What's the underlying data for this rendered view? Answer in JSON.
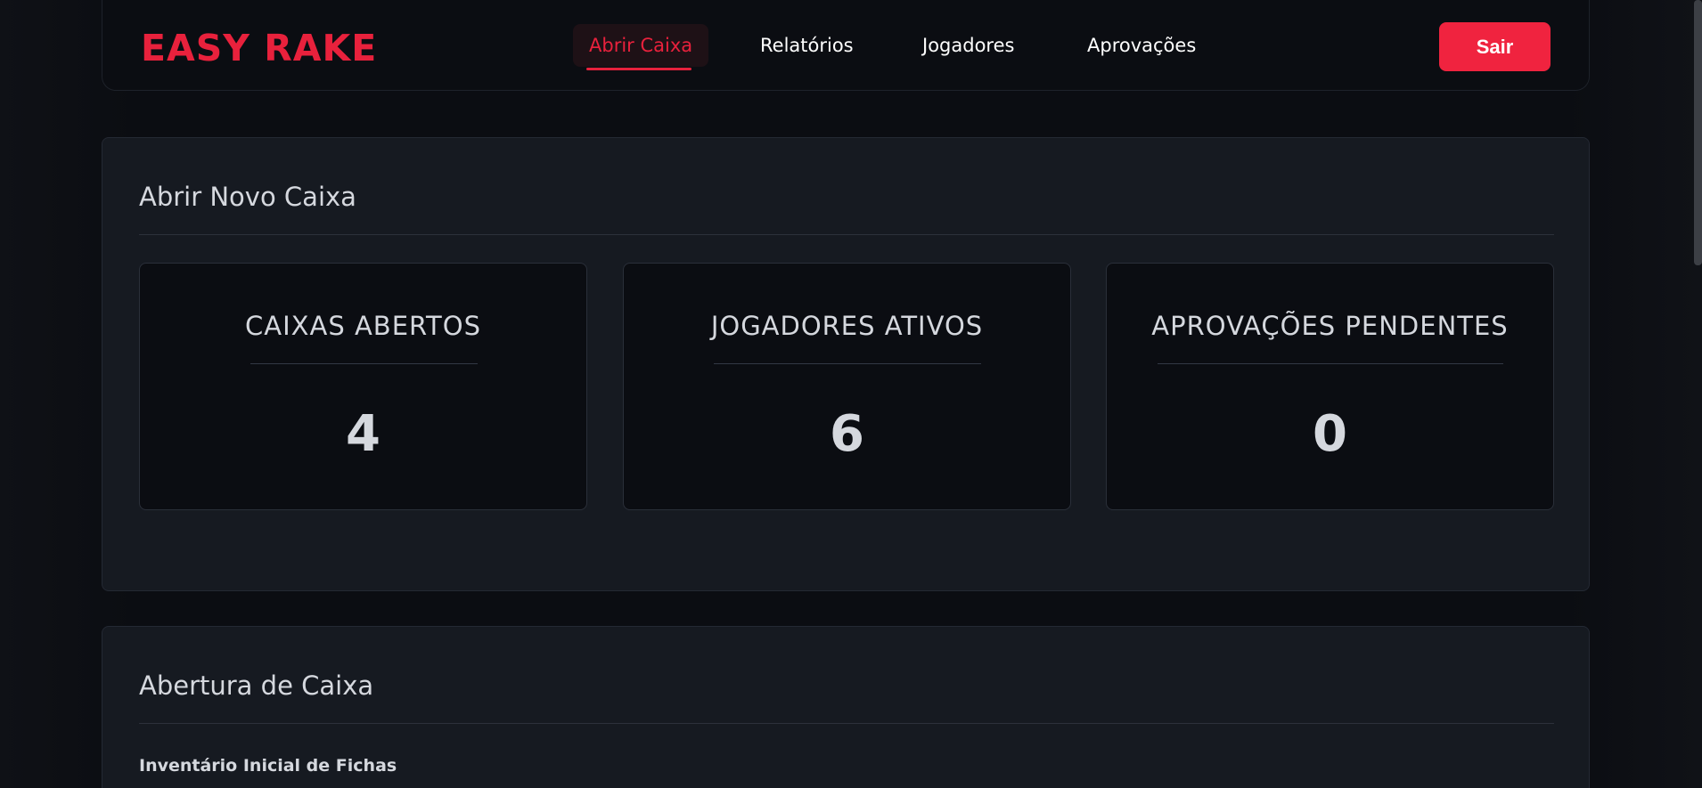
{
  "header": {
    "brand": "EASY RAKE",
    "nav": [
      {
        "label": "Abrir Caixa",
        "active": true
      },
      {
        "label": "Relatórios",
        "active": false
      },
      {
        "label": "Jogadores",
        "active": false
      },
      {
        "label": "Aprovações",
        "active": false
      }
    ],
    "logout_label": "Sair"
  },
  "panel_open": {
    "title": "Abrir Novo Caixa",
    "stats": [
      {
        "label": "CAIXAS ABERTOS",
        "value": "4"
      },
      {
        "label": "JOGADORES ATIVOS",
        "value": "6"
      },
      {
        "label": "APROVAÇÕES PENDENTES",
        "value": "0"
      }
    ]
  },
  "panel_opening": {
    "title": "Abertura de Caixa",
    "section_label": "Inventário Inicial de Fichas"
  },
  "colors": {
    "accent": "#e8213c",
    "background": "#0b0d12",
    "panel": "#161a21",
    "text": "#d5d8de"
  }
}
